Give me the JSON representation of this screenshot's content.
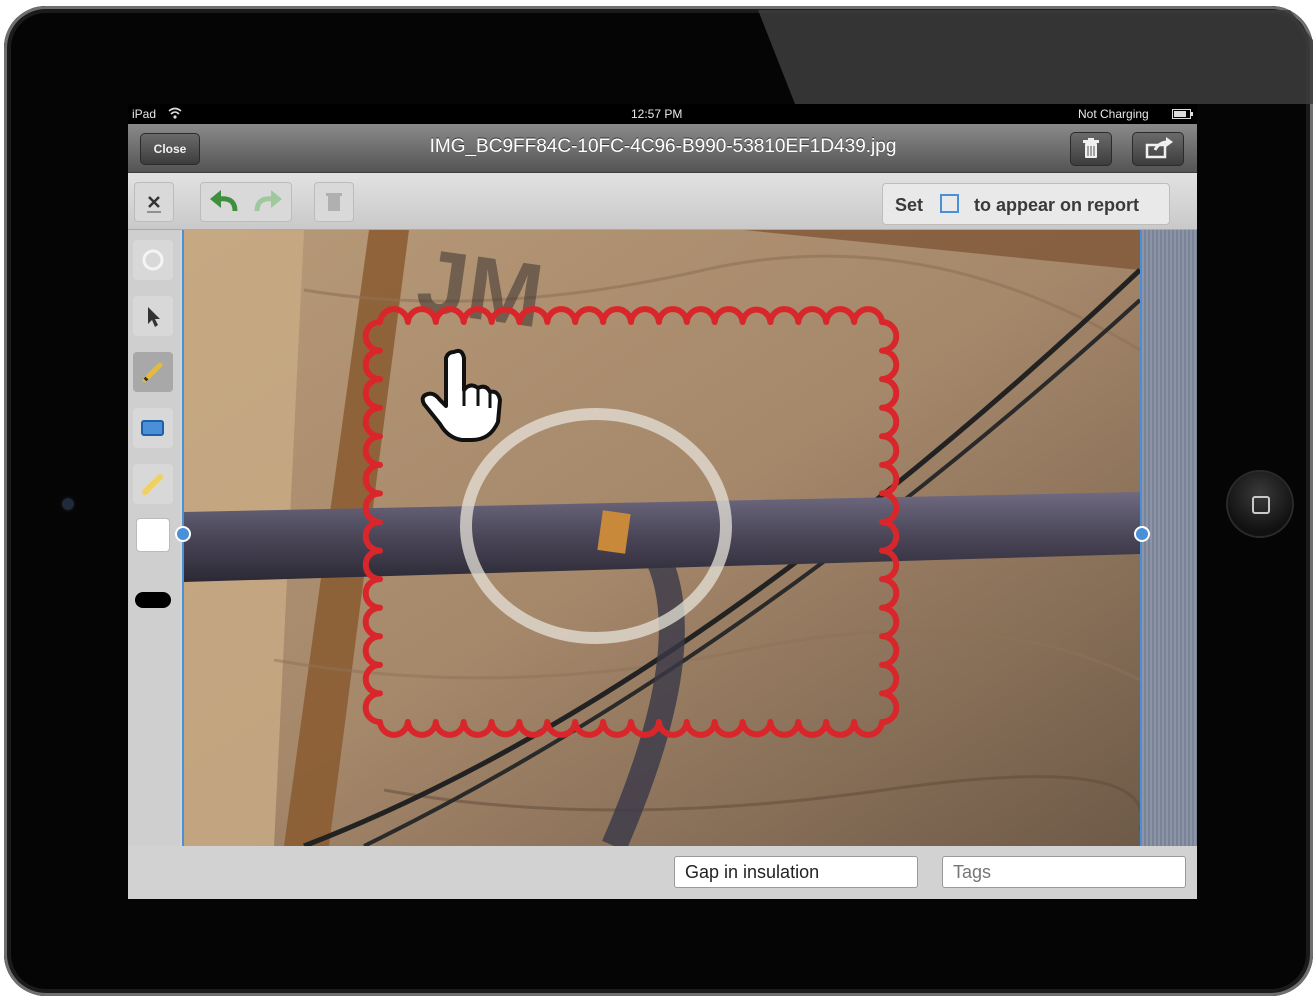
{
  "status_bar": {
    "device": "iPad",
    "time": "12:57 PM",
    "battery_status": "Not Charging",
    "icons": [
      "wifi-icon",
      "battery-icon"
    ]
  },
  "header": {
    "close_label": "Close",
    "file_name": "IMG_BC9FF84C-10FC-4C96-B990-53810EF1D439.jpg",
    "icons": [
      "trash-icon",
      "share-icon"
    ]
  },
  "toolbar": {
    "icons": [
      "close-x-icon",
      "undo-icon",
      "redo-icon",
      "delete-icon"
    ],
    "report_hint": {
      "prefix": "Set",
      "suffix": "to appear on report",
      "icon": "selection-rect-icon"
    }
  },
  "sidebar": {
    "tools": [
      "hand-icon",
      "pointer-icon",
      "pen-icon",
      "rectangle-icon",
      "highlighter-icon",
      "fill-color-swatch",
      "stroke-color-swatch"
    ],
    "active_tool": "pen-icon",
    "fill_color": "#ffffff",
    "stroke_color": "#000000"
  },
  "canvas": {
    "annotations": [
      "scalloped-cloud-markup",
      "circle-markup"
    ],
    "markup_color": "#d9262b",
    "circle_color": "#e6e1d8"
  },
  "footer": {
    "caption_value": "Gap in insulation",
    "tags_placeholder": "Tags"
  },
  "colors": {
    "accent": "#4a90d9",
    "undo_arrow": "#3f8f3f"
  }
}
